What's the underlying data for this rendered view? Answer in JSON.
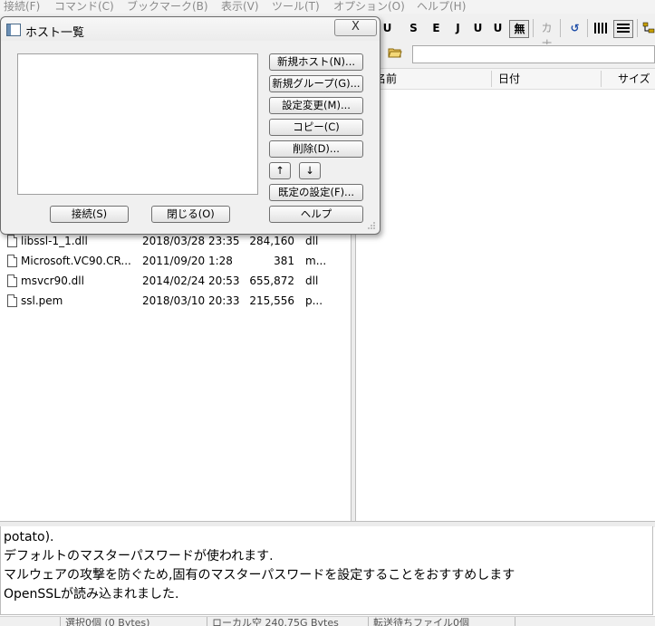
{
  "menubar": {
    "items": [
      "接続(F)",
      "コマンド(C)",
      "ブックマーク(B)",
      "表示(V)",
      "ツール(T)",
      "オプション(O)",
      "ヘルプ(H)"
    ]
  },
  "toolbar": {
    "buttons": [
      "S",
      "E",
      "J",
      "U",
      "U",
      "無",
      "カナ"
    ]
  },
  "right_pane": {
    "columns": [
      "名前",
      "日付",
      "サイズ"
    ]
  },
  "left_files": [
    {
      "name": "libssl-1_1.dll",
      "date": "2018/03/28 23:35",
      "size": "284,160",
      "type": "dll"
    },
    {
      "name": "Microsoft.VC90.CR...",
      "date": "2011/09/20  1:28",
      "size": "381",
      "type": "m..."
    },
    {
      "name": "msvcr90.dll",
      "date": "2014/02/24 20:53",
      "size": "655,872",
      "type": "dll"
    },
    {
      "name": "ssl.pem",
      "date": "2018/03/10 20:33",
      "size": "215,556",
      "type": "p..."
    }
  ],
  "log": {
    "lines": [
      "potato).",
      "デフォルトのマスターパスワードが使われます.",
      "マルウェアの攻撃を防ぐため,固有のマスターパスワードを設定することをおすすめします",
      "OpenSSLが読み込まれました."
    ]
  },
  "statusbar": {
    "selection": "選択0個 (0 Bytes)",
    "free": "ローカル空 240.75G Bytes",
    "queue": "転送待ちファイル0個"
  },
  "dialog": {
    "title": "ホスト一覧",
    "close": "X",
    "buttons": {
      "new_host": "新規ホスト(N)...",
      "new_group": "新規グループ(G)...",
      "edit": "設定変更(M)...",
      "copy": "コピー(C)",
      "delete": "削除(D)...",
      "up": "↑",
      "down": "↓",
      "default_settings": "既定の設定(F)...",
      "connect": "接続(S)",
      "close_btn": "閉じる(O)",
      "help": "ヘルプ"
    }
  }
}
